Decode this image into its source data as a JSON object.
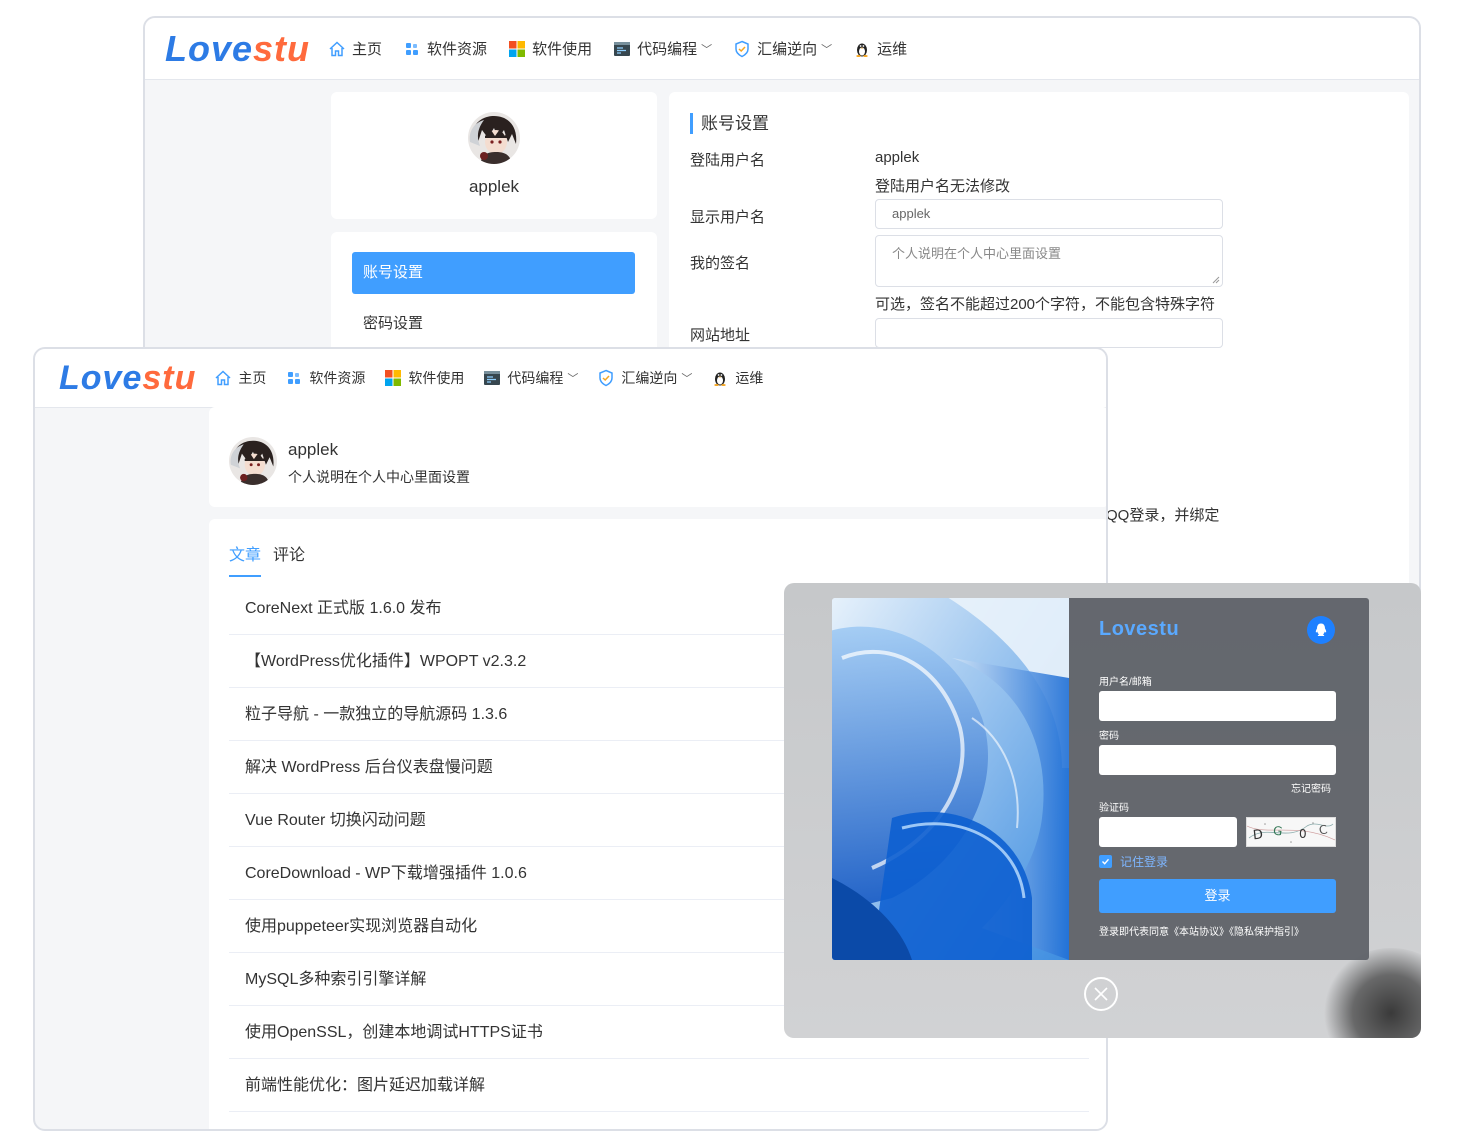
{
  "brand": {
    "logo_main": "Love",
    "logo_accent": "stu"
  },
  "nav": [
    {
      "label": "主页",
      "icon": "home-icon",
      "dropdown": false
    },
    {
      "label": "软件资源",
      "icon": "apps-icon",
      "dropdown": false
    },
    {
      "label": "软件使用",
      "icon": "windows-icon",
      "dropdown": false
    },
    {
      "label": "代码编程",
      "icon": "code-window-icon",
      "dropdown": true
    },
    {
      "label": "汇编逆向",
      "icon": "shield-icon",
      "dropdown": true
    },
    {
      "label": "运维",
      "icon": "linux-penguin-icon",
      "dropdown": false
    }
  ],
  "profile": {
    "username": "applek"
  },
  "side_menu": {
    "active": "账号设置",
    "items": [
      "密码设置"
    ]
  },
  "settings": {
    "title": "账号设置",
    "login_username_label": "登陆用户名",
    "login_username_value": "applek",
    "login_username_note": "登陆用户名无法修改",
    "display_name_label": "显示用户名",
    "display_name_value": "applek",
    "signature_label": "我的签名",
    "signature_placeholder": "个人说明在个人中心里面设置",
    "signature_hint": "可选，签名不能超过200个字符，不能包含特殊字符",
    "website_label": "网站地址",
    "qq_hint_partial": "QQ登录，并绑定"
  },
  "user_strip": {
    "name": "applek",
    "signature": "个人说明在个人中心里面设置"
  },
  "tabs": [
    {
      "label": "文章",
      "active": true
    },
    {
      "label": "评论",
      "active": false
    }
  ],
  "posts": [
    "CoreNext 正式版 1.6.0 发布",
    "【WordPress优化插件】WPOPT v2.3.2",
    "粒子导航 - 一款独立的导航源码 1.3.6",
    "解决 WordPress 后台仪表盘慢问题",
    "Vue Router 切换闪动问题",
    "CoreDownload - WP下载增强插件 1.0.6",
    "使用puppeteer实现浏览器自动化",
    "MySQL多种索引引擎详解",
    "使用OpenSSL，创建本地调试HTTPS证书",
    "前端性能优化：图片延迟加载详解"
  ],
  "login": {
    "logo": "Lovestu",
    "username_label": "用户名/邮箱",
    "password_label": "密码",
    "forgot": "忘记密码",
    "captcha_label": "验证码",
    "captcha_text": "DG0C",
    "remember": "记住登录",
    "remember_checked": true,
    "submit": "登录",
    "agreement": "登录即代表同意《本站协议》《隐私保护指引》"
  },
  "colors": {
    "primary": "#409eff",
    "logo_blue": "#2d7be5",
    "logo_orange": "#ff6a3d"
  }
}
